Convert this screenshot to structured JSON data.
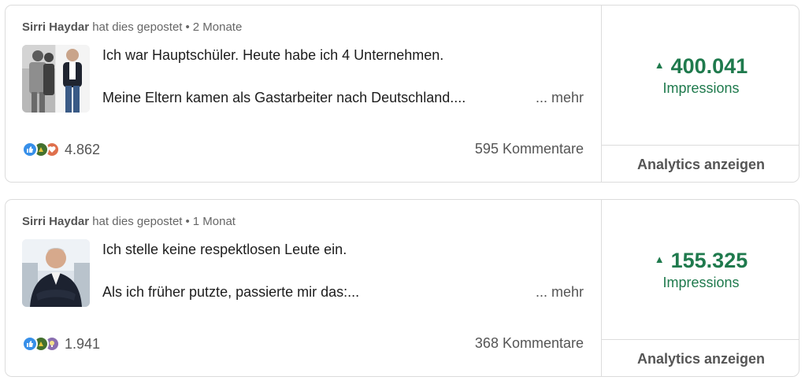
{
  "posts": [
    {
      "author": "Sirri Haydar",
      "action": "hat dies gepostet",
      "age": "2 Monate",
      "line1": "Ich war Hauptschüler. Heute habe ich 4 Unternehmen.",
      "line2": "Meine Eltern kamen als Gastarbeiter nach Deutschland....",
      "more_label": "... mehr",
      "reaction_icons": [
        "like-icon",
        "celebrate-icon",
        "love-icon"
      ],
      "reactions": "4.862",
      "comments": "595 Kommentare",
      "impressions": "400.041",
      "impressions_label": "Impressions",
      "analytics_label": "Analytics anzeigen"
    },
    {
      "author": "Sirri Haydar",
      "action": "hat dies gepostet",
      "age": "1 Monat",
      "line1": "Ich stelle keine respektlosen Leute ein.",
      "line2": "Als ich früher putzte, passierte mir das:...",
      "more_label": "... mehr",
      "reaction_icons": [
        "like-icon",
        "celebrate-icon",
        "insightful-icon"
      ],
      "reactions": "1.941",
      "comments": "368 Kommentare",
      "impressions": "155.325",
      "impressions_label": "Impressions",
      "analytics_label": "Analytics anzeigen"
    }
  ],
  "colors": {
    "impressions_green": "#1f7a4d",
    "like_blue": "#378fe9",
    "celebrate_green": "#44712e",
    "love_orange": "#df704d",
    "insight_purple": "#8a6fb0"
  }
}
